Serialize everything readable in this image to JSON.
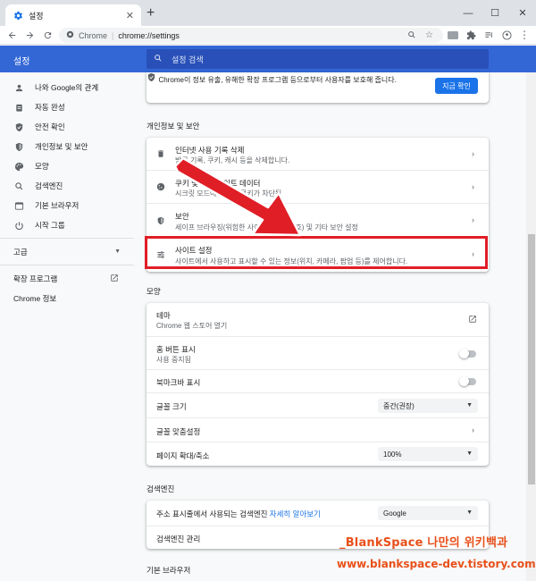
{
  "browser": {
    "tab_title": "설정",
    "new_tab_symbol": "+",
    "omnibox_site": "Chrome",
    "omnibox_url": "chrome://settings"
  },
  "header": {
    "title": "설정",
    "search_placeholder": "설정 검색"
  },
  "sidebar": {
    "items": [
      {
        "label": "나와 Google의 관계",
        "icon": "person-icon"
      },
      {
        "label": "자동 완성",
        "icon": "clipboard-icon"
      },
      {
        "label": "안전 확인",
        "icon": "shield-check-icon"
      },
      {
        "label": "개인정보 및 보안",
        "icon": "shield-icon"
      },
      {
        "label": "모양",
        "icon": "palette-icon"
      },
      {
        "label": "검색엔진",
        "icon": "search-icon"
      },
      {
        "label": "기본 브라우저",
        "icon": "browser-icon"
      },
      {
        "label": "시작 그룹",
        "icon": "power-icon"
      }
    ],
    "advanced_label": "고급",
    "extensions_label": "확장 프로그램",
    "about_label": "Chrome 정보"
  },
  "safety": {
    "text": "Chrome이 정보 유출, 유해한 확장 프로그램 등으로부터 사용자를 보호해 줍니다.",
    "button_label": "지금 확인"
  },
  "privacy": {
    "section_title": "개인정보 및 보안",
    "rows": [
      {
        "title": "인터넷 사용 기록 삭제",
        "subtitle": "방문 기록, 쿠키, 캐시 등을 삭제합니다."
      },
      {
        "title": "쿠키 및 기타 사이트 데이터",
        "subtitle": "시크릿 모드에서 타사 쿠키가 차단됨"
      },
      {
        "title": "보안",
        "subtitle": "세이프 브라우징(위험한 사이트로부터 보호) 및 기타 보안 설정"
      },
      {
        "title": "사이트 설정",
        "subtitle": "사이트에서 사용하고 표시할 수 있는 정보(위치, 카메라, 팝업 등)를 제어합니다."
      }
    ]
  },
  "appearance": {
    "section_title": "모양",
    "theme_title": "테마",
    "theme_subtitle": "Chrome 웹 스토어 열기",
    "home_title": "홈 버튼 표시",
    "home_subtitle": "사용 중지됨",
    "bookmarks_title": "북마크바 표시",
    "fontsize_title": "글꼴 크기",
    "fontsize_value": "중간(권장)",
    "customfont_title": "글꼴 맞춤설정",
    "zoom_title": "페이지 확대/축소",
    "zoom_value": "100%"
  },
  "search": {
    "section_title": "검색엔진",
    "engine_text": "주소 표시줄에서 사용되는 검색엔진",
    "engine_link": "자세히 알아보기",
    "engine_value": "Google",
    "manage_title": "검색엔진 관리"
  },
  "default_browser": {
    "section_title": "기본 브라우저"
  },
  "watermark": {
    "line1": "_BlankSpace 나만의 위키백과",
    "line2": "www.blankspace-dev.tistory.com"
  },
  "colors": {
    "header_blue": "#3367d6",
    "accent": "#1a73e8",
    "highlight_red": "#e01e26",
    "watermark": "#e8501a"
  }
}
